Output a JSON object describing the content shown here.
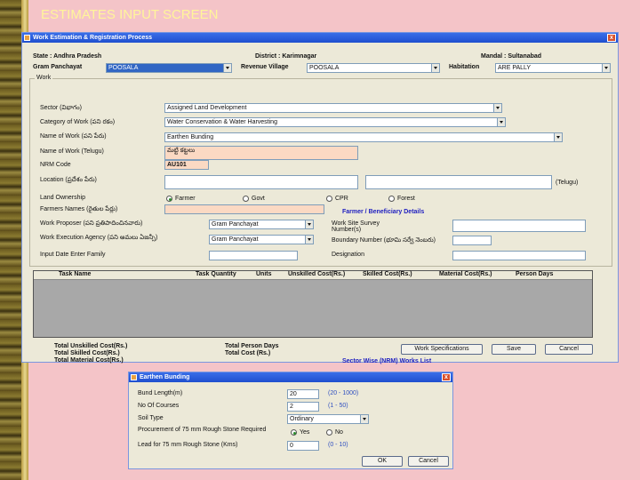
{
  "slide_title": "ESTIMATES INPUT SCREEN",
  "main_window": {
    "title": "Work Estimation & Registration Process",
    "close": "x",
    "state": "State : Andhra Pradesh",
    "district": "District : Karimnagar",
    "mandal": "Mandal : Sultanabad",
    "gp_label": "Gram Panchayat",
    "gp_value": "POOSALA",
    "village_label": "Revenue Village",
    "village_value": "POOSALA",
    "habitation_label": "Habitation",
    "habitation_value": "ARE PALLY",
    "work_frame": "Work",
    "sector_label": "Sector (విభాగం)",
    "sector_value": "Assigned Land Development",
    "category_label": "Category of Work (పని రకం)",
    "category_value": "Water Conservation & Water Harvesting",
    "name_label": "Name of Work (పని పేరు)",
    "name_value": "Earthen Bunding",
    "name_telugu_label": "Name of Work (Telugu)",
    "name_telugu_value": "మట్టి కట్టలు",
    "nrm_label": "NRM Code",
    "nrm_value": "AU101",
    "location_label": "Location (ప్రదేశం పేరు)",
    "location_suffix": "(Telugu)",
    "land_label": "Land Ownership",
    "land_options": [
      "Farmer",
      "Govt",
      "CPR",
      "Forest"
    ],
    "farmers_label": "Farmers Names (రైతుల పేర్లు)",
    "beneficiary_link": "Farmer / Beneficiary Details",
    "proposer_label": "Work Proposer (పని ప్రతిపాదించినవారు)",
    "proposer_value": "Gram Panchayat",
    "agency_label": "Work Execution Agency (పని అమలు ఏజన్సీ)",
    "agency_value": "Gram Panchayat",
    "survey_label": "Work Site Survey Number(s)",
    "boundary_label": "Boundary Number (భూమి సర్వే నెంబరు)",
    "eip_label": "Input Date Enter Family",
    "designation_label": "Designation",
    "grid_headers": [
      "Task Name",
      "Task Quantity",
      "Units",
      "Unskilled Cost(Rs.)",
      "Skilled Cost(Rs.)",
      "Material Cost(Rs.)",
      "Person Days"
    ],
    "totals": {
      "unskilled": "Total Unskilled Cost(Rs.)",
      "skilled": "Total Skilled Cost(Rs.)",
      "material": "Total Material Cost(Rs.)",
      "person_days": "Total Person Days",
      "cost": "Total Cost (Rs.)"
    },
    "spec_button": "Work Specifications",
    "save_button": "Save",
    "cancel_button": "Cancel",
    "bottom_link": "Sector Wise (NRM) Works List"
  },
  "dialog": {
    "title": "Earthen Bunding",
    "close": "x",
    "rows": [
      {
        "label": "Bund Length(m)",
        "value": "20",
        "hint": "(20 - 1000)"
      },
      {
        "label": "No Of Courses",
        "value": "2",
        "hint": "(1 - 50)"
      },
      {
        "label": "Soil Type",
        "value": "Ordinary",
        "hint": ""
      }
    ],
    "procurement_label": "Procurement of 75 mm Rough Stone Required",
    "yes": "Yes",
    "no": "No",
    "lead_label": "Lead for 75 mm Rough Stone (Kms)",
    "lead_value": "0",
    "lead_hint": "(0 - 10)",
    "ok": "OK",
    "cancel": "Cancel"
  }
}
